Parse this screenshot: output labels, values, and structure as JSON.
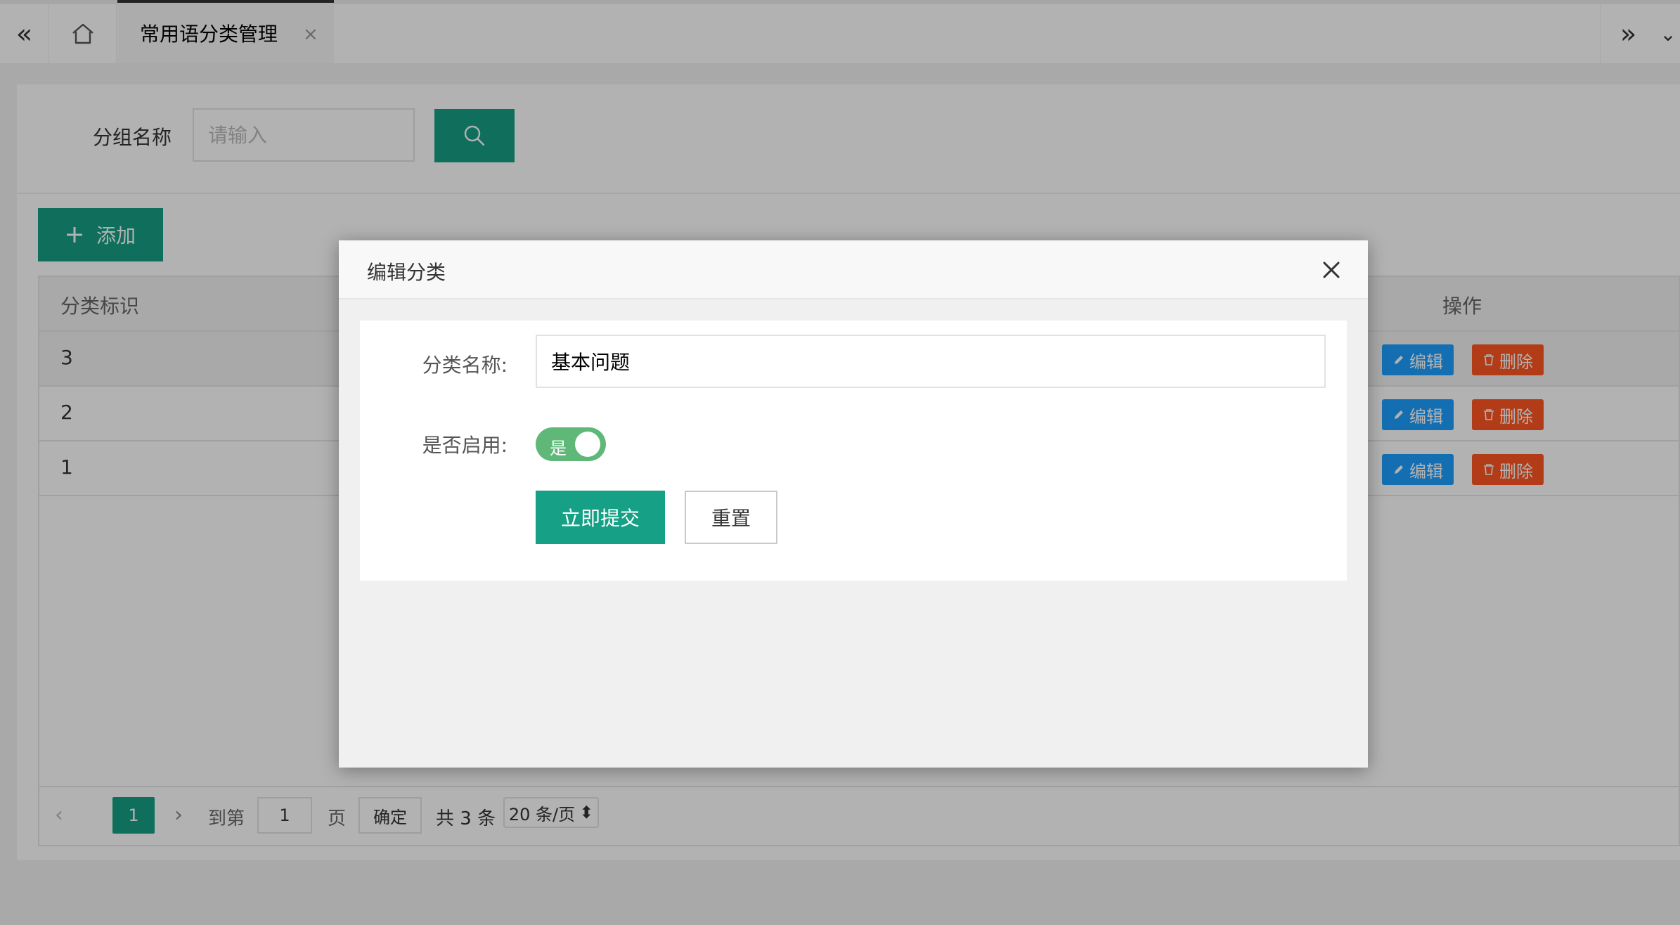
{
  "tabbar": {
    "active_tab": "常用语分类管理",
    "close_glyph": "×",
    "left_glyph": "«",
    "right_glyph": "»",
    "more_glyph": "⌄"
  },
  "search": {
    "label": "分组名称",
    "placeholder": "请输入"
  },
  "toolbar": {
    "add_label": "添加"
  },
  "table": {
    "columns": [
      "分类标识",
      "操作"
    ],
    "rows": [
      {
        "id": "3",
        "edit_label": "编辑",
        "delete_label": "删除"
      },
      {
        "id": "2",
        "edit_label": "编辑",
        "delete_label": "删除"
      },
      {
        "id": "1",
        "edit_label": "编辑",
        "delete_label": "删除"
      }
    ]
  },
  "pager": {
    "prev": "‹",
    "current": "1",
    "next": "›",
    "goto_label": "到第",
    "goto_value": "1",
    "page_label": "页",
    "confirm_label": "确定",
    "total_label": "共 3 条",
    "page_size": "20 条/页",
    "page_size_arrow": "⬍"
  },
  "modal": {
    "title": "编辑分类",
    "name_label": "分类名称:",
    "name_value": "基本问题",
    "enabled_label": "是否启用:",
    "switch_text": "是",
    "submit_label": "立即提交",
    "reset_label": "重置"
  },
  "colors": {
    "primary": "#16a085",
    "edit": "#1e9fff",
    "delete": "#ff5722",
    "switch_on": "#5fb878"
  }
}
